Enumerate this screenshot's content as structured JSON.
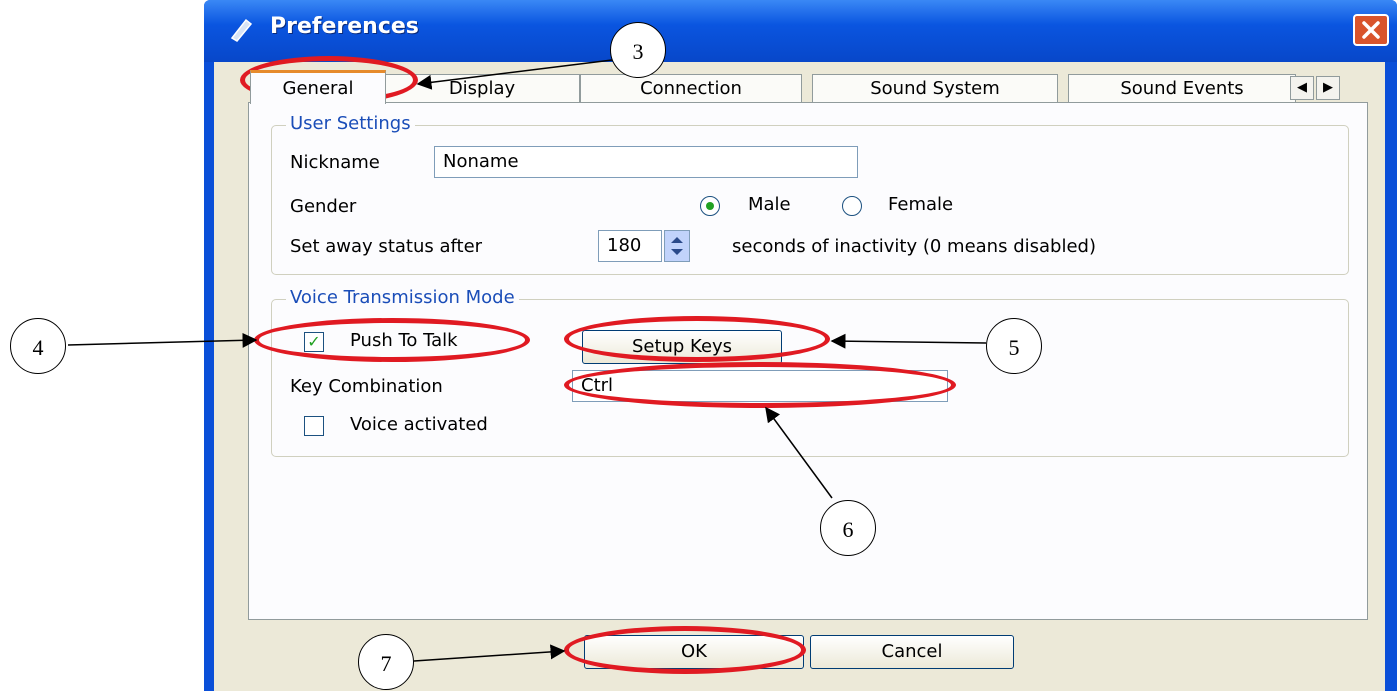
{
  "window": {
    "title": "Preferences"
  },
  "tabs": [
    "General",
    "Display",
    "Connection",
    "Sound System",
    "Sound Events"
  ],
  "user_settings": {
    "group_title": "User Settings",
    "nickname_label": "Nickname",
    "nickname_value": "Noname",
    "gender_label": "Gender",
    "gender_options": [
      "Male",
      "Female"
    ],
    "gender_selected": "Male",
    "away_label": "Set away status after",
    "away_value": "180",
    "away_suffix": "seconds of inactivity (0 means disabled)"
  },
  "voice": {
    "group_title": "Voice Transmission Mode",
    "push_to_talk_label": "Push To Talk",
    "push_to_talk_checked": true,
    "setup_keys_label": "Setup Keys",
    "key_combination_label": "Key Combination",
    "key_combination_value": "Ctrl",
    "voice_activated_label": "Voice activated",
    "voice_activated_checked": false
  },
  "buttons": {
    "ok": "OK",
    "cancel": "Cancel"
  },
  "callouts": [
    "3",
    "4",
    "5",
    "6",
    "7"
  ],
  "colors": {
    "highlight": "#e01a22",
    "titlebar": "#0a55e0",
    "accent_tab": "#e68b2c"
  },
  "icons": [
    "window-icon",
    "close-icon",
    "tab-scroll-left-icon",
    "tab-scroll-right-icon",
    "spin-icon"
  ]
}
